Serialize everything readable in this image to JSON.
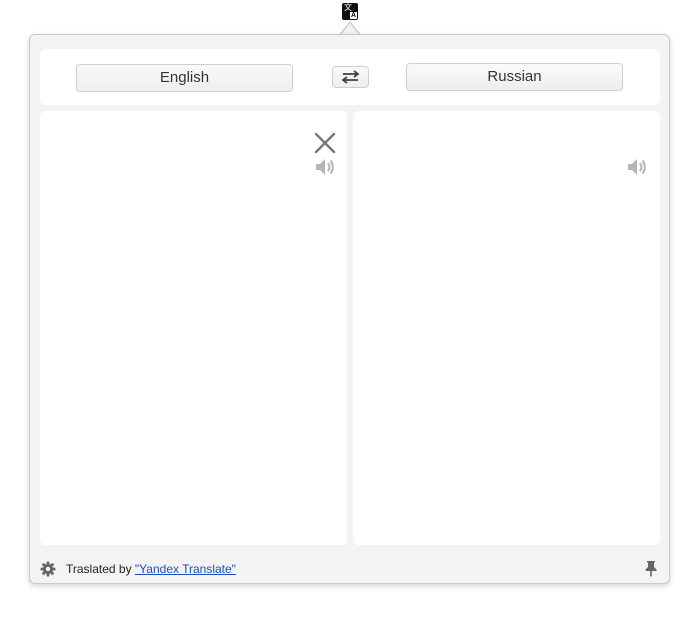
{
  "languages": {
    "source": "English",
    "target": "Russian"
  },
  "footer": {
    "translated_by": "Traslated by ",
    "provider_link": "\"Yandex Translate\""
  },
  "icons": {
    "menubar": "translate-icon",
    "swap": "swap-arrows-icon",
    "clear": "close-icon",
    "speak": "speaker-icon",
    "settings": "gear-icon",
    "pin": "pin-icon"
  }
}
